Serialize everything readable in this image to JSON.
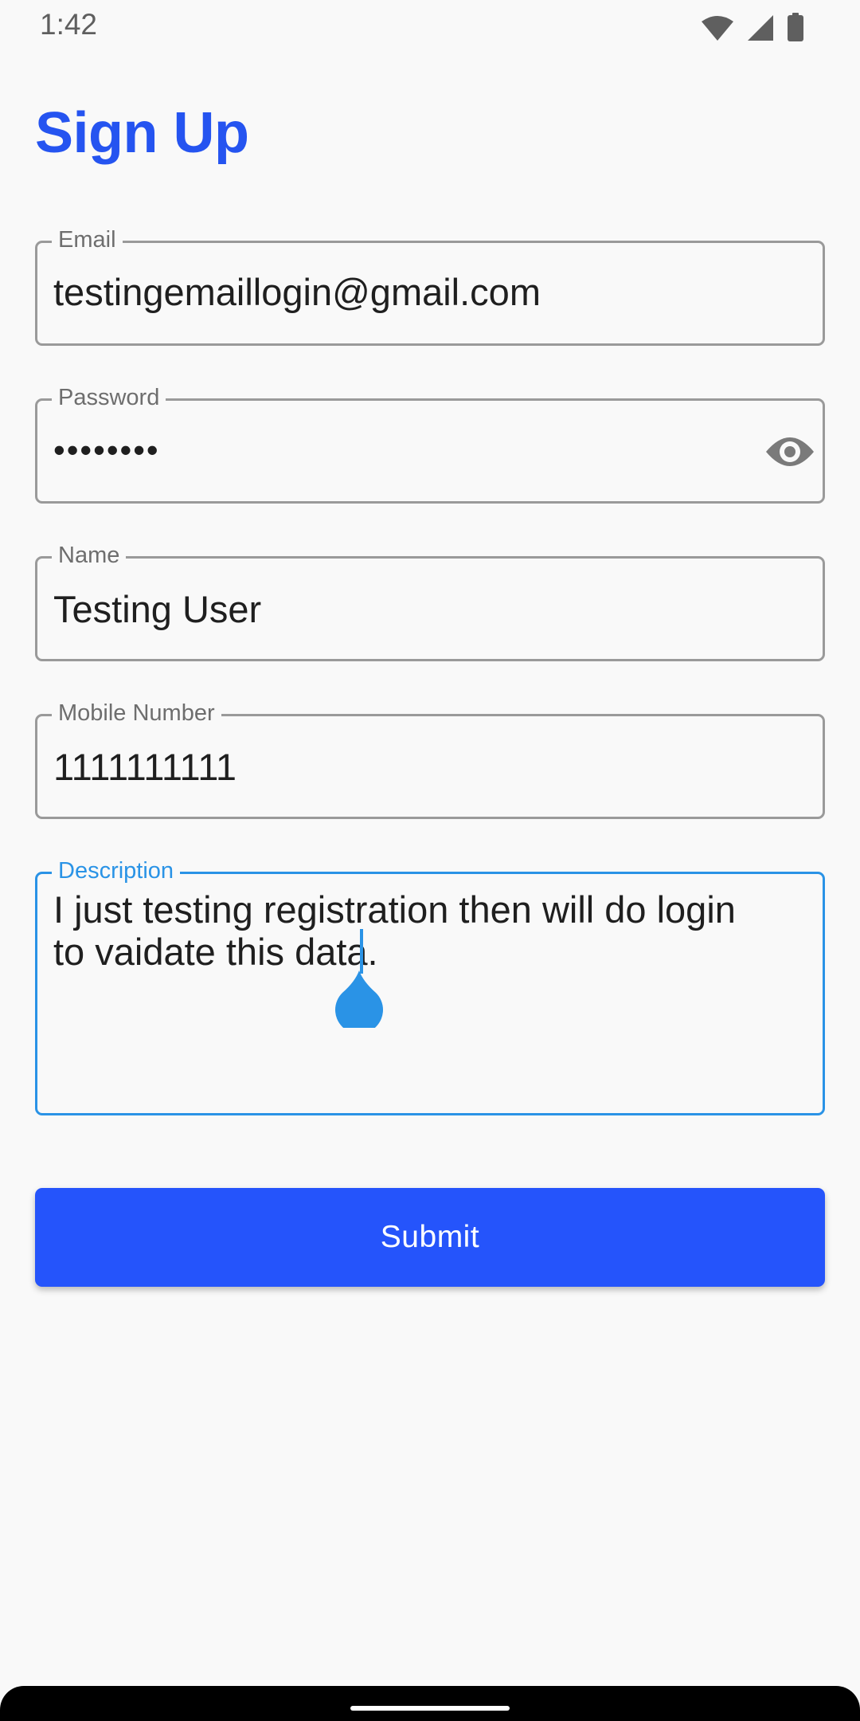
{
  "status_bar": {
    "time": "1:42",
    "icons": [
      "wifi-icon",
      "cellular-signal-icon",
      "battery-icon"
    ]
  },
  "page": {
    "title": "Sign Up"
  },
  "form": {
    "email": {
      "label": "Email",
      "value": "testingemaillogin@gmail.com"
    },
    "password": {
      "label": "Password",
      "value": "••••••••",
      "toggle_icon": "eye-icon"
    },
    "name": {
      "label": "Name",
      "value": "Testing User"
    },
    "mobile": {
      "label": "Mobile Number",
      "value": "1111111111"
    },
    "description": {
      "label": "Description",
      "value": "I just testing registration then will do login to vaidate this data."
    }
  },
  "submit": {
    "label": "Submit"
  },
  "colors": {
    "accent": "#2554f0",
    "button": "#2554fb",
    "focus": "#2a93e6",
    "border": "#9a9a9a"
  }
}
